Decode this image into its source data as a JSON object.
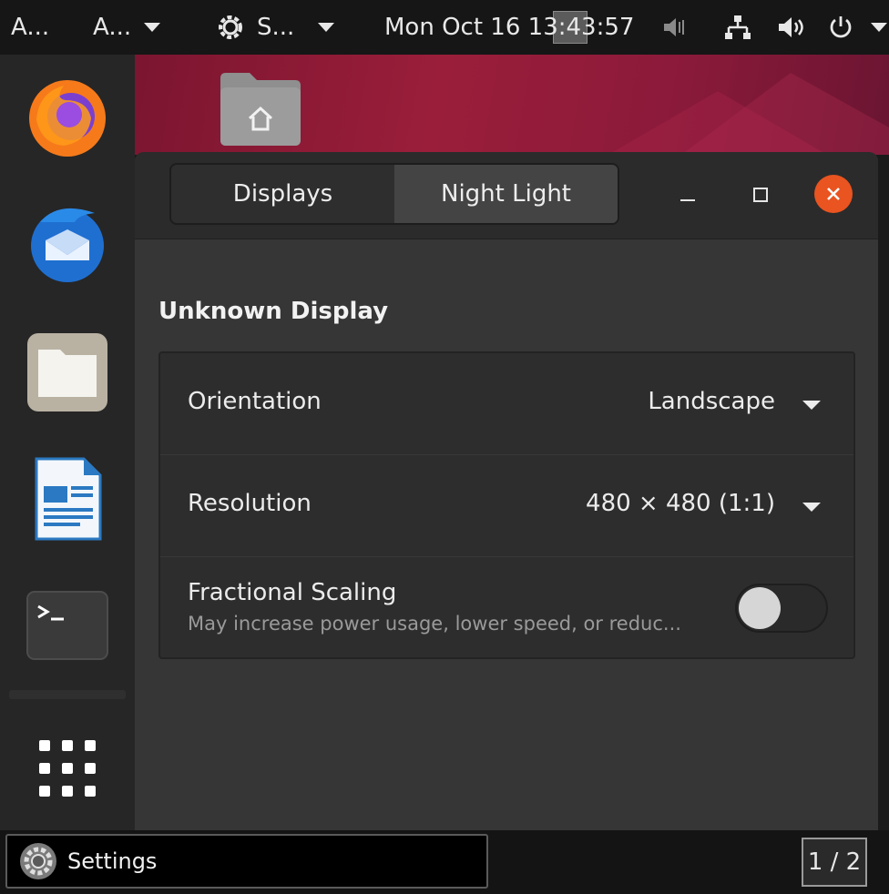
{
  "topbar": {
    "activities_label": "A...",
    "app_menu_label": "A...",
    "settings_menu_label": "S...",
    "clock": "Mon Oct 16  13:43:57"
  },
  "window": {
    "tabs": [
      {
        "label": "Displays",
        "active": false
      },
      {
        "label": "Night Light",
        "active": true
      }
    ],
    "section_title": "Unknown Display",
    "orientation": {
      "label": "Orientation",
      "value": "Landscape"
    },
    "resolution": {
      "label": "Resolution",
      "value": "480 × 480 (1:1)"
    },
    "fractional_scaling": {
      "label": "Fractional Scaling",
      "description": "May increase power usage, lower speed, or reduc...",
      "enabled": false
    }
  },
  "taskbar": {
    "task_label": "Settings",
    "workspace": "1 / 2"
  },
  "colors": {
    "close_button": "#e95420",
    "wallpaper": "#8c1a3a",
    "panel": "#363636"
  },
  "icons": [
    "firefox-icon",
    "thunderbird-icon",
    "files-icon",
    "writer-icon",
    "terminal-icon",
    "app-grid-icon",
    "home-folder-icon",
    "gear-icon",
    "network-icon",
    "volume-icon",
    "power-icon",
    "mic-icon"
  ]
}
